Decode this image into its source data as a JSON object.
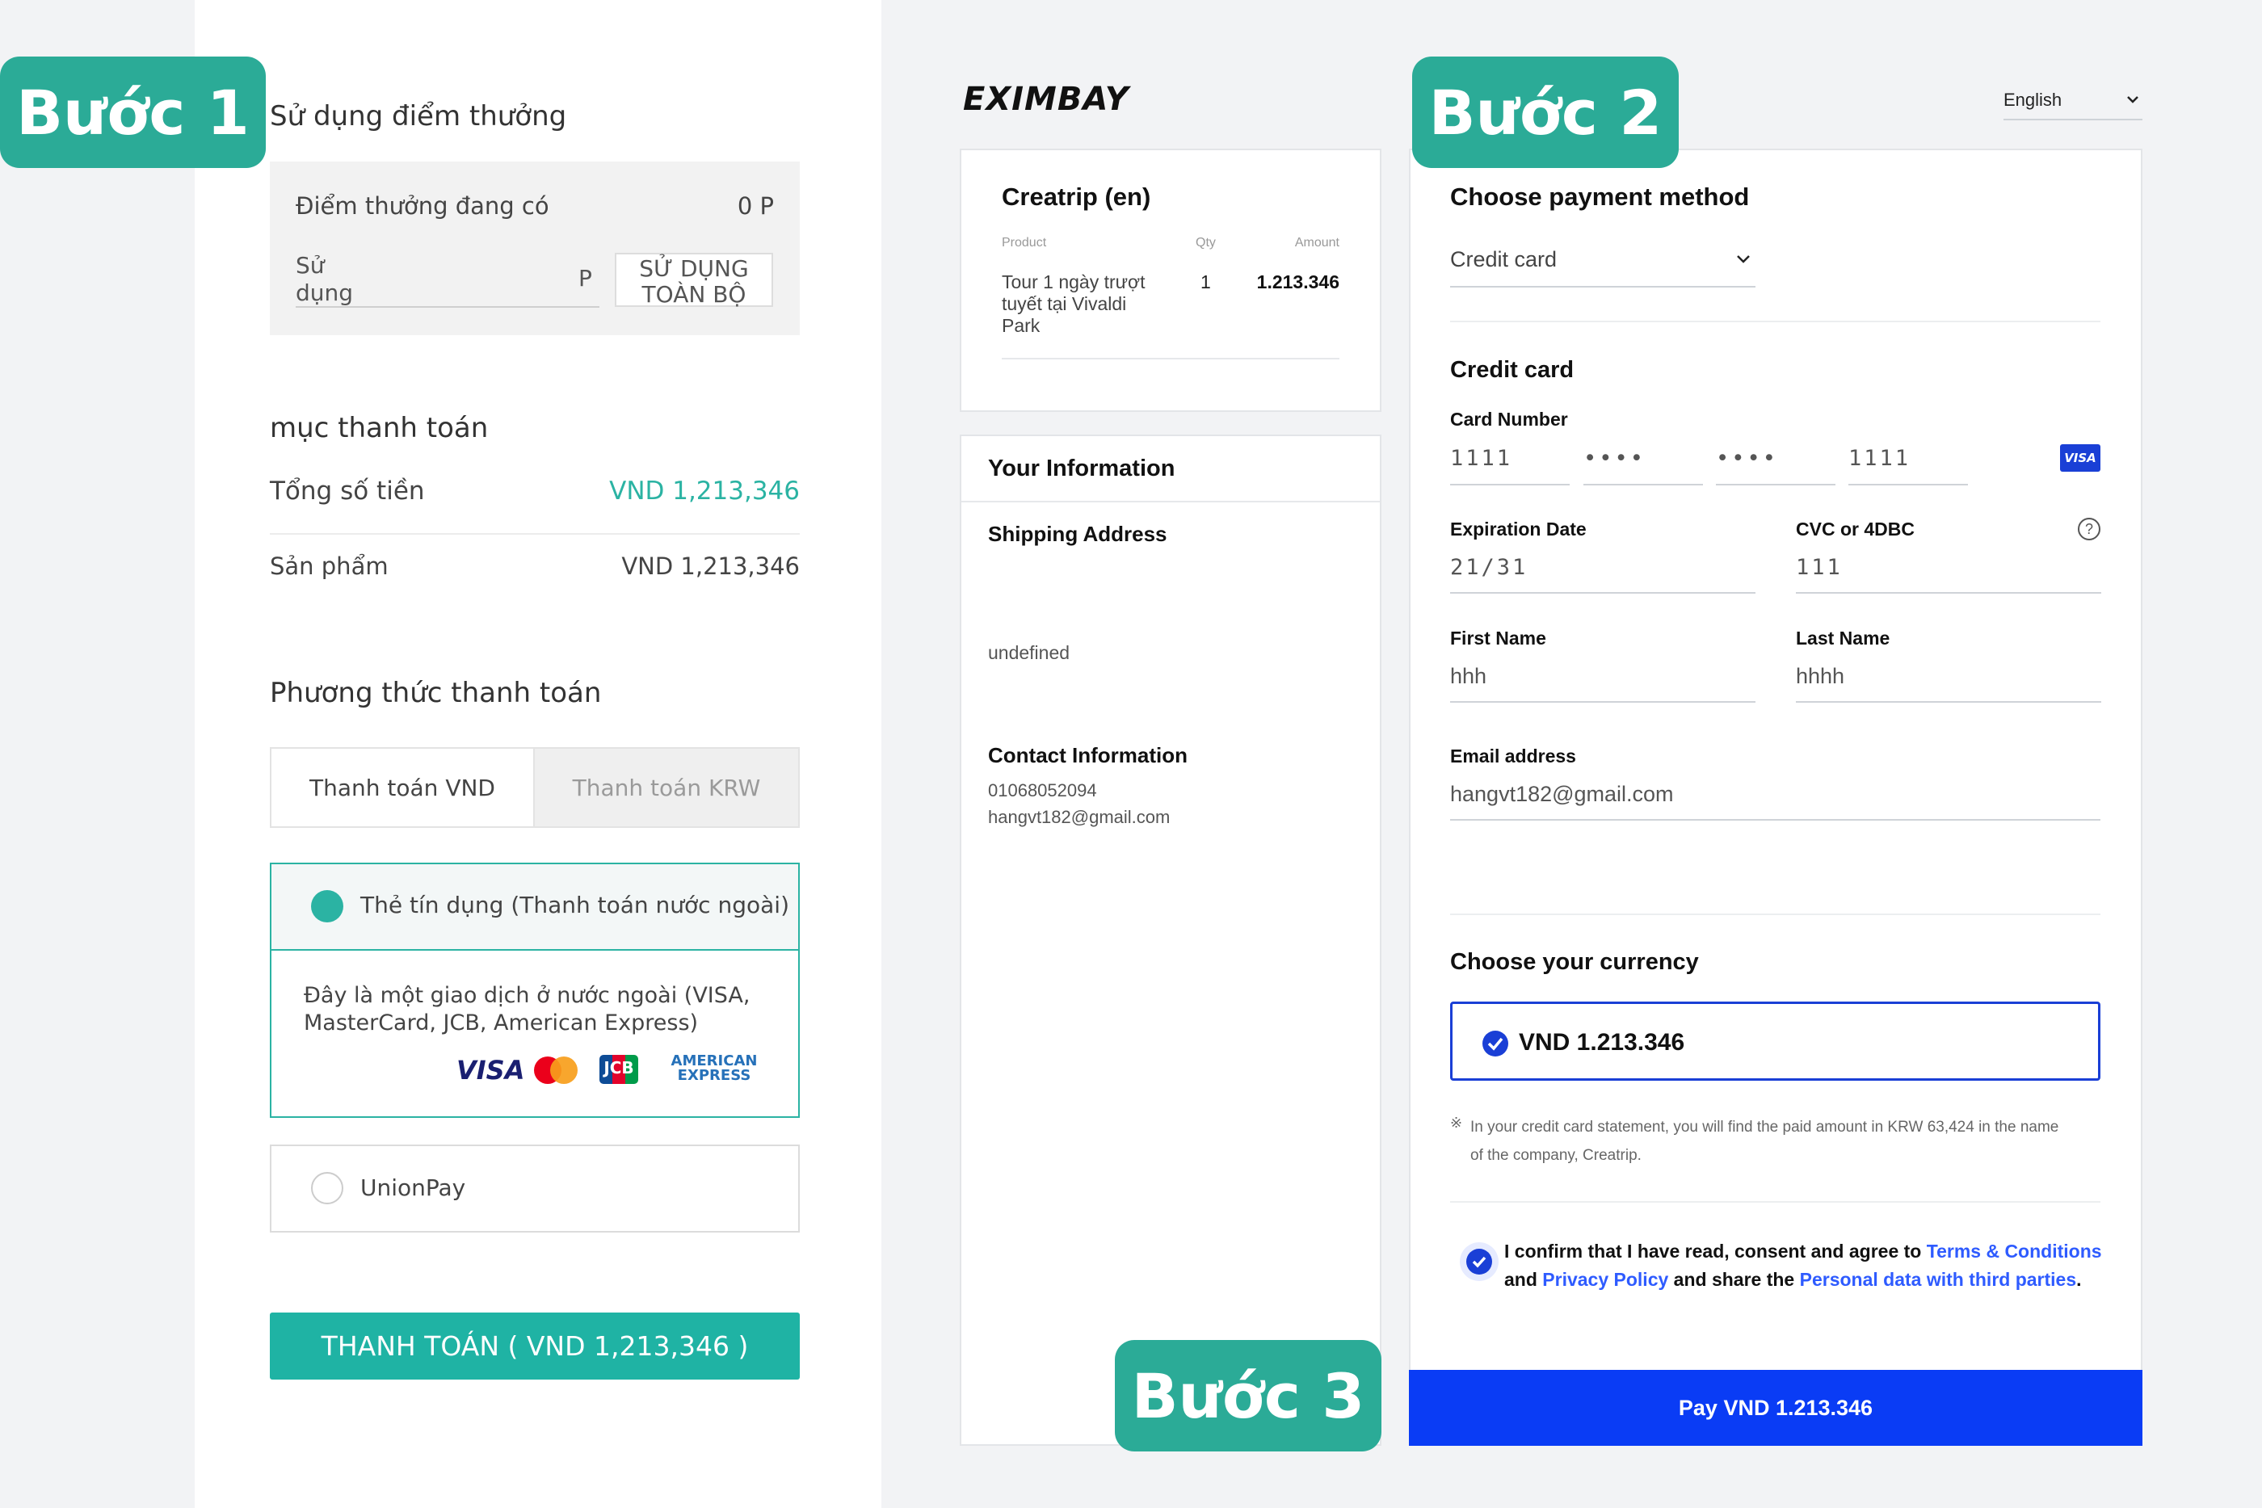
{
  "steps": [
    "Bước 1",
    "Bước 2",
    "Bước 3"
  ],
  "left": {
    "points_title": "Sử dụng điểm thưởng",
    "points_available_label": "Điểm thưởng đang có",
    "points_available_value": "0 P",
    "points_use_label_line1": "Sử",
    "points_use_label_line2": "dụng",
    "points_unit": "P",
    "use_all_line1": "SỬ DỤNG",
    "use_all_line2": "TOÀN BỘ",
    "payment_items_title": "mục thanh toán",
    "total_label": "Tổng số tiền",
    "total_value": "VND 1,213,346",
    "product_label": "Sản phẩm",
    "product_value": "VND 1,213,346",
    "payment_method_title": "Phương thức thanh toán",
    "tab_vnd": "Thanh toán VND",
    "tab_krw": "Thanh toán KRW",
    "credit_option_label": "Thẻ tín dụng (Thanh toán nước ngoài)",
    "credit_desc_line1": "Đây là một giao dịch ở nước ngoài (VISA,",
    "credit_desc_line2": "MasterCard, JCB, American Express)",
    "brands": {
      "visa": "VISA",
      "jcb": "JCB",
      "amex_line1": "AMERICAN",
      "amex_line2": "EXPRESS"
    },
    "unionpay_label": "UnionPay",
    "pay_button": "THANH TOÁN ( VND 1,213,346 )"
  },
  "eximbay": {
    "logo": "EXIMBAY",
    "language": "English",
    "order": {
      "merchant": "Creatrip (en)",
      "col_product": "Product",
      "col_qty": "Qty",
      "col_amount": "Amount",
      "product_line1": "Tour 1 ngày trượt",
      "product_line2": "tuyết tại Vivaldi",
      "product_line3": "Park",
      "qty": "1",
      "amount": "1.213.346"
    },
    "info": {
      "title": "Your Information",
      "shipping_title": "Shipping Address",
      "shipping_value": "undefined",
      "contact_title": "Contact Information",
      "phone": "01068052094",
      "email": "hangvt182@gmail.com"
    },
    "payment": {
      "choose_title": "Choose payment method",
      "method_selected": "Credit card",
      "cc_title": "Credit card",
      "card_number_label": "Card Number",
      "card_parts": [
        "1111",
        "••••",
        "••••",
        "1111"
      ],
      "card_brand": "VISA",
      "exp_label": "Expiration Date",
      "exp_value": "21/31",
      "cvc_label": "CVC or 4DBC",
      "cvc_help": "?",
      "cvc_value": "111",
      "first_name_label": "First Name",
      "first_name_value": "hhh",
      "last_name_label": "Last Name",
      "last_name_value": "hhhh",
      "email_label": "Email address",
      "email_value": "hangvt182@gmail.com",
      "currency_title": "Choose your currency",
      "currency_option": "VND 1.213.346",
      "note_mark": "※",
      "note_line1": "In your credit card statement, you will find the paid amount in KRW 63,424 in the name",
      "note_line2": "of the company, Creatrip.",
      "consent_t1": "I confirm that I have read, consent and agree to ",
      "consent_l1": "Terms & Conditions",
      "consent_t2": "and ",
      "consent_l2": "Privacy Policy",
      "consent_t3": " and share the ",
      "consent_l3": "Personal data with third parties",
      "consent_t4": ".",
      "pay_button": "Pay VND 1.213.346"
    }
  },
  "colors": {
    "teal": "#2bab97",
    "teal_button": "#1fb3a4",
    "eximbay_blue": "#0a3cf5",
    "link_blue": "#2e5bff"
  }
}
